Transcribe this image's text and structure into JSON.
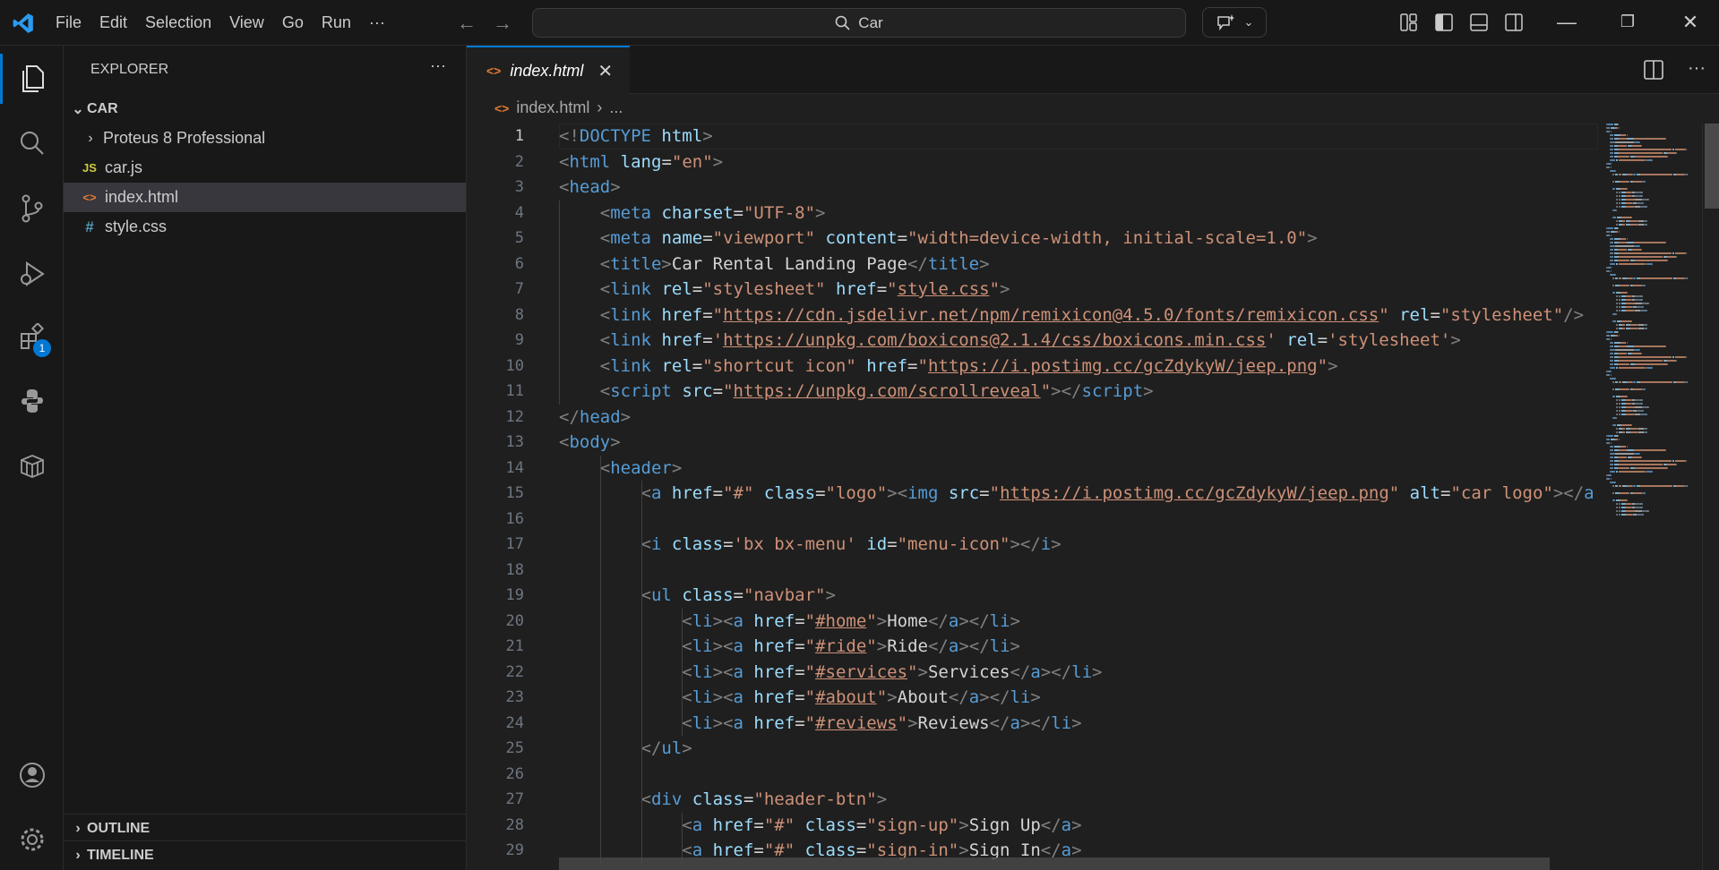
{
  "titlebar": {
    "menu": [
      "File",
      "Edit",
      "Selection",
      "View",
      "Go",
      "Run",
      "···"
    ],
    "search": "Car"
  },
  "sidebar": {
    "title": "EXPLORER",
    "more": "···",
    "folder": "CAR",
    "items": [
      {
        "name": "Proteus 8 Professional",
        "type": "folder"
      },
      {
        "name": "car.js",
        "type": "js",
        "icon": "JS"
      },
      {
        "name": "index.html",
        "type": "html",
        "icon": "<>"
      },
      {
        "name": "style.css",
        "type": "css",
        "icon": "#"
      }
    ],
    "outline": "OUTLINE",
    "timeline": "TIMELINE"
  },
  "activity": {
    "extensions_badge": "1"
  },
  "tab": {
    "label": "index.html",
    "close": "✕"
  },
  "breadcrumb": {
    "file": "index.html",
    "rest": "..."
  },
  "colors": {
    "accent": "#0078d4",
    "tag": "#569cd6",
    "attr": "#9cdcfe",
    "string": "#ce9178",
    "punct": "#808080"
  },
  "editor": {
    "current_line": 1,
    "lines": [
      [
        [
          "p",
          "<!"
        ],
        [
          "t",
          "DOCTYPE"
        ],
        [
          "x",
          " "
        ],
        [
          "a",
          "html"
        ],
        [
          "p",
          ">"
        ]
      ],
      [
        [
          "p",
          "<"
        ],
        [
          "t",
          "html"
        ],
        [
          "x",
          " "
        ],
        [
          "a",
          "lang"
        ],
        [
          "x",
          "="
        ],
        [
          "s",
          "\"en\""
        ],
        [
          "p",
          ">"
        ]
      ],
      [
        [
          "p",
          "<"
        ],
        [
          "t",
          "head"
        ],
        [
          "p",
          ">"
        ]
      ],
      [
        [
          "x",
          "    "
        ],
        [
          "p",
          "<"
        ],
        [
          "t",
          "meta"
        ],
        [
          "x",
          " "
        ],
        [
          "a",
          "charset"
        ],
        [
          "x",
          "="
        ],
        [
          "s",
          "\"UTF-8\""
        ],
        [
          "p",
          ">"
        ]
      ],
      [
        [
          "x",
          "    "
        ],
        [
          "p",
          "<"
        ],
        [
          "t",
          "meta"
        ],
        [
          "x",
          " "
        ],
        [
          "a",
          "name"
        ],
        [
          "x",
          "="
        ],
        [
          "s",
          "\"viewport\""
        ],
        [
          "x",
          " "
        ],
        [
          "a",
          "content"
        ],
        [
          "x",
          "="
        ],
        [
          "s",
          "\"width=device-width, initial-scale=1.0\""
        ],
        [
          "p",
          ">"
        ]
      ],
      [
        [
          "x",
          "    "
        ],
        [
          "p",
          "<"
        ],
        [
          "t",
          "title"
        ],
        [
          "p",
          ">"
        ],
        [
          "x",
          "Car Rental Landing Page"
        ],
        [
          "p",
          "</"
        ],
        [
          "t",
          "title"
        ],
        [
          "p",
          ">"
        ]
      ],
      [
        [
          "x",
          "    "
        ],
        [
          "p",
          "<"
        ],
        [
          "t",
          "link"
        ],
        [
          "x",
          " "
        ],
        [
          "a",
          "rel"
        ],
        [
          "x",
          "="
        ],
        [
          "s",
          "\"stylesheet\""
        ],
        [
          "x",
          " "
        ],
        [
          "a",
          "href"
        ],
        [
          "x",
          "="
        ],
        [
          "s",
          "\""
        ],
        [
          "u",
          "style.css"
        ],
        [
          "s",
          "\""
        ],
        [
          "p",
          ">"
        ]
      ],
      [
        [
          "x",
          "    "
        ],
        [
          "p",
          "<"
        ],
        [
          "t",
          "link"
        ],
        [
          "x",
          " "
        ],
        [
          "a",
          "href"
        ],
        [
          "x",
          "="
        ],
        [
          "s",
          "\""
        ],
        [
          "u",
          "https://cdn.jsdelivr.net/npm/remixicon@4.5.0/fonts/remixicon.css"
        ],
        [
          "s",
          "\""
        ],
        [
          "x",
          " "
        ],
        [
          "a",
          "rel"
        ],
        [
          "x",
          "="
        ],
        [
          "s",
          "\"stylesheet\""
        ],
        [
          "p",
          "/>"
        ]
      ],
      [
        [
          "x",
          "    "
        ],
        [
          "p",
          "<"
        ],
        [
          "t",
          "link"
        ],
        [
          "x",
          " "
        ],
        [
          "a",
          "href"
        ],
        [
          "x",
          "="
        ],
        [
          "s",
          "'"
        ],
        [
          "u",
          "https://unpkg.com/boxicons@2.1.4/css/boxicons.min.css"
        ],
        [
          "s",
          "'"
        ],
        [
          "x",
          " "
        ],
        [
          "a",
          "rel"
        ],
        [
          "x",
          "="
        ],
        [
          "s",
          "'stylesheet'"
        ],
        [
          "p",
          ">"
        ]
      ],
      [
        [
          "x",
          "    "
        ],
        [
          "p",
          "<"
        ],
        [
          "t",
          "link"
        ],
        [
          "x",
          " "
        ],
        [
          "a",
          "rel"
        ],
        [
          "x",
          "="
        ],
        [
          "s",
          "\"shortcut icon\""
        ],
        [
          "x",
          " "
        ],
        [
          "a",
          "href"
        ],
        [
          "x",
          "="
        ],
        [
          "s",
          "\""
        ],
        [
          "u",
          "https://i.postimg.cc/gcZdykyW/jeep.png"
        ],
        [
          "s",
          "\""
        ],
        [
          "p",
          ">"
        ]
      ],
      [
        [
          "x",
          "    "
        ],
        [
          "p",
          "<"
        ],
        [
          "t",
          "script"
        ],
        [
          "x",
          " "
        ],
        [
          "a",
          "src"
        ],
        [
          "x",
          "="
        ],
        [
          "s",
          "\""
        ],
        [
          "u",
          "https://unpkg.com/scrollreveal"
        ],
        [
          "s",
          "\""
        ],
        [
          "p",
          "></"
        ],
        [
          "t",
          "script"
        ],
        [
          "p",
          ">"
        ]
      ],
      [
        [
          "p",
          "</"
        ],
        [
          "t",
          "head"
        ],
        [
          "p",
          ">"
        ]
      ],
      [
        [
          "p",
          "<"
        ],
        [
          "t",
          "body"
        ],
        [
          "p",
          ">"
        ]
      ],
      [
        [
          "x",
          "    "
        ],
        [
          "p",
          "<"
        ],
        [
          "t",
          "header"
        ],
        [
          "p",
          ">"
        ]
      ],
      [
        [
          "x",
          "        "
        ],
        [
          "p",
          "<"
        ],
        [
          "t",
          "a"
        ],
        [
          "x",
          " "
        ],
        [
          "a",
          "href"
        ],
        [
          "x",
          "="
        ],
        [
          "s",
          "\"#\""
        ],
        [
          "x",
          " "
        ],
        [
          "a",
          "class"
        ],
        [
          "x",
          "="
        ],
        [
          "s",
          "\"logo\""
        ],
        [
          "p",
          "><"
        ],
        [
          "t",
          "img"
        ],
        [
          "x",
          " "
        ],
        [
          "a",
          "src"
        ],
        [
          "x",
          "="
        ],
        [
          "s",
          "\""
        ],
        [
          "u",
          "https://i.postimg.cc/gcZdykyW/jeep.png"
        ],
        [
          "s",
          "\""
        ],
        [
          "x",
          " "
        ],
        [
          "a",
          "alt"
        ],
        [
          "x",
          "="
        ],
        [
          "s",
          "\"car logo\""
        ],
        [
          "p",
          "></"
        ],
        [
          "t",
          "a"
        ]
      ],
      [],
      [
        [
          "x",
          "        "
        ],
        [
          "p",
          "<"
        ],
        [
          "t",
          "i"
        ],
        [
          "x",
          " "
        ],
        [
          "a",
          "class"
        ],
        [
          "x",
          "="
        ],
        [
          "s",
          "'bx bx-menu'"
        ],
        [
          "x",
          " "
        ],
        [
          "a",
          "id"
        ],
        [
          "x",
          "="
        ],
        [
          "s",
          "\"menu-icon\""
        ],
        [
          "p",
          "></"
        ],
        [
          "t",
          "i"
        ],
        [
          "p",
          ">"
        ]
      ],
      [],
      [
        [
          "x",
          "        "
        ],
        [
          "p",
          "<"
        ],
        [
          "t",
          "ul"
        ],
        [
          "x",
          " "
        ],
        [
          "a",
          "class"
        ],
        [
          "x",
          "="
        ],
        [
          "s",
          "\"navbar\""
        ],
        [
          "p",
          ">"
        ]
      ],
      [
        [
          "x",
          "            "
        ],
        [
          "p",
          "<"
        ],
        [
          "t",
          "li"
        ],
        [
          "p",
          "><"
        ],
        [
          "t",
          "a"
        ],
        [
          "x",
          " "
        ],
        [
          "a",
          "href"
        ],
        [
          "x",
          "="
        ],
        [
          "s",
          "\""
        ],
        [
          "u",
          "#home"
        ],
        [
          "s",
          "\""
        ],
        [
          "p",
          ">"
        ],
        [
          "x",
          "Home"
        ],
        [
          "p",
          "</"
        ],
        [
          "t",
          "a"
        ],
        [
          "p",
          "></"
        ],
        [
          "t",
          "li"
        ],
        [
          "p",
          ">"
        ]
      ],
      [
        [
          "x",
          "            "
        ],
        [
          "p",
          "<"
        ],
        [
          "t",
          "li"
        ],
        [
          "p",
          "><"
        ],
        [
          "t",
          "a"
        ],
        [
          "x",
          " "
        ],
        [
          "a",
          "href"
        ],
        [
          "x",
          "="
        ],
        [
          "s",
          "\""
        ],
        [
          "u",
          "#ride"
        ],
        [
          "s",
          "\""
        ],
        [
          "p",
          ">"
        ],
        [
          "x",
          "Ride"
        ],
        [
          "p",
          "</"
        ],
        [
          "t",
          "a"
        ],
        [
          "p",
          "></"
        ],
        [
          "t",
          "li"
        ],
        [
          "p",
          ">"
        ]
      ],
      [
        [
          "x",
          "            "
        ],
        [
          "p",
          "<"
        ],
        [
          "t",
          "li"
        ],
        [
          "p",
          "><"
        ],
        [
          "t",
          "a"
        ],
        [
          "x",
          " "
        ],
        [
          "a",
          "href"
        ],
        [
          "x",
          "="
        ],
        [
          "s",
          "\""
        ],
        [
          "u",
          "#services"
        ],
        [
          "s",
          "\""
        ],
        [
          "p",
          ">"
        ],
        [
          "x",
          "Services"
        ],
        [
          "p",
          "</"
        ],
        [
          "t",
          "a"
        ],
        [
          "p",
          "></"
        ],
        [
          "t",
          "li"
        ],
        [
          "p",
          ">"
        ]
      ],
      [
        [
          "x",
          "            "
        ],
        [
          "p",
          "<"
        ],
        [
          "t",
          "li"
        ],
        [
          "p",
          "><"
        ],
        [
          "t",
          "a"
        ],
        [
          "x",
          " "
        ],
        [
          "a",
          "href"
        ],
        [
          "x",
          "="
        ],
        [
          "s",
          "\""
        ],
        [
          "u",
          "#about"
        ],
        [
          "s",
          "\""
        ],
        [
          "p",
          ">"
        ],
        [
          "x",
          "About"
        ],
        [
          "p",
          "</"
        ],
        [
          "t",
          "a"
        ],
        [
          "p",
          "></"
        ],
        [
          "t",
          "li"
        ],
        [
          "p",
          ">"
        ]
      ],
      [
        [
          "x",
          "            "
        ],
        [
          "p",
          "<"
        ],
        [
          "t",
          "li"
        ],
        [
          "p",
          "><"
        ],
        [
          "t",
          "a"
        ],
        [
          "x",
          " "
        ],
        [
          "a",
          "href"
        ],
        [
          "x",
          "="
        ],
        [
          "s",
          "\""
        ],
        [
          "u",
          "#reviews"
        ],
        [
          "s",
          "\""
        ],
        [
          "p",
          ">"
        ],
        [
          "x",
          "Reviews"
        ],
        [
          "p",
          "</"
        ],
        [
          "t",
          "a"
        ],
        [
          "p",
          "></"
        ],
        [
          "t",
          "li"
        ],
        [
          "p",
          ">"
        ]
      ],
      [
        [
          "x",
          "        "
        ],
        [
          "p",
          "</"
        ],
        [
          "t",
          "ul"
        ],
        [
          "p",
          ">"
        ]
      ],
      [],
      [
        [
          "x",
          "        "
        ],
        [
          "p",
          "<"
        ],
        [
          "t",
          "div"
        ],
        [
          "x",
          " "
        ],
        [
          "a",
          "class"
        ],
        [
          "x",
          "="
        ],
        [
          "s",
          "\"header-btn\""
        ],
        [
          "p",
          ">"
        ]
      ],
      [
        [
          "x",
          "            "
        ],
        [
          "p",
          "<"
        ],
        [
          "t",
          "a"
        ],
        [
          "x",
          " "
        ],
        [
          "a",
          "href"
        ],
        [
          "x",
          "="
        ],
        [
          "s",
          "\"#\""
        ],
        [
          "x",
          " "
        ],
        [
          "a",
          "class"
        ],
        [
          "x",
          "="
        ],
        [
          "s",
          "\"sign-up\""
        ],
        [
          "p",
          ">"
        ],
        [
          "x",
          "Sign Up"
        ],
        [
          "p",
          "</"
        ],
        [
          "t",
          "a"
        ],
        [
          "p",
          ">"
        ]
      ],
      [
        [
          "x",
          "            "
        ],
        [
          "p",
          "<"
        ],
        [
          "t",
          "a"
        ],
        [
          "x",
          " "
        ],
        [
          "a",
          "href"
        ],
        [
          "x",
          "="
        ],
        [
          "s",
          "\"#\""
        ],
        [
          "x",
          " "
        ],
        [
          "a",
          "class"
        ],
        [
          "x",
          "="
        ],
        [
          "s",
          "\"sign-in\""
        ],
        [
          "p",
          ">"
        ],
        [
          "x",
          "Sign In"
        ],
        [
          "p",
          "</"
        ],
        [
          "t",
          "a"
        ],
        [
          "p",
          ">"
        ]
      ]
    ]
  }
}
